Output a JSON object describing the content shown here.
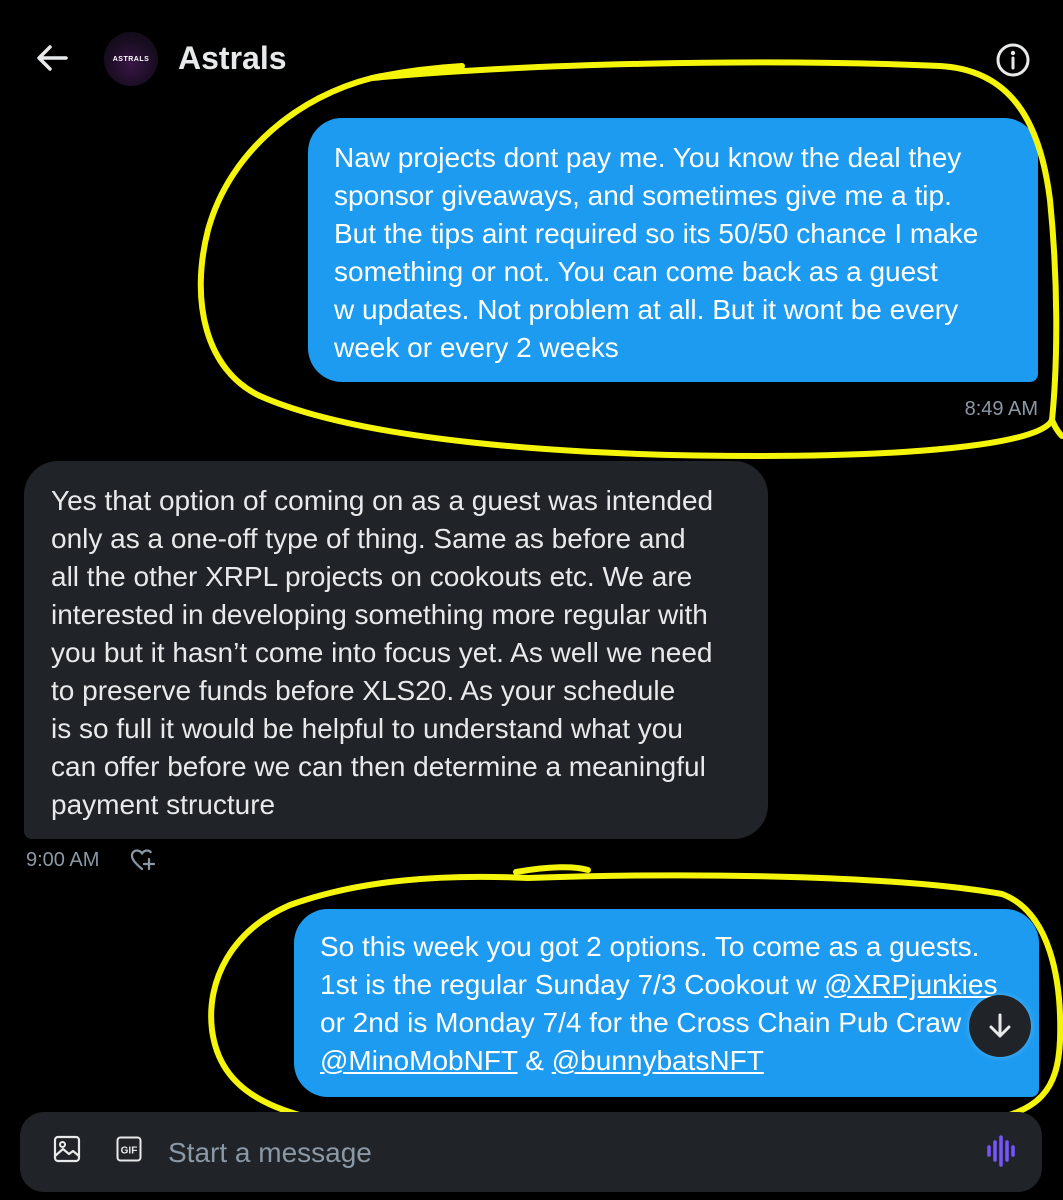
{
  "header": {
    "title": "Astrals",
    "avatar_text": "ASTRALS",
    "back_icon": "arrow-left-icon",
    "info_icon": "info-icon"
  },
  "messages": [
    {
      "direction": "outgoing",
      "text": "Naw projects dont pay me. You know the deal they\nsponsor  giveaways, and sometimes give me a tip.\nBut the tips aint required so its 50/50 chance I make\nsomething or not. You can come back as a guest\nw updates. Not problem at all. But it wont be every\nweek or every 2 weeks",
      "time": "8:49 AM"
    },
    {
      "direction": "incoming",
      "text": "Yes that option of coming on as a guest was intended\nonly as a one-off type of thing. Same as before and\nall the other XRPL projects on cookouts etc. We are\ninterested in developing something more regular with\nyou but it hasn’t come into focus yet. As well we need\nto preserve funds before XLS20. As your schedule\nis so full it would be helpful to understand what you\ncan offer before we can then determine a meaningful\npayment structure",
      "time": "9:00 AM"
    },
    {
      "direction": "outgoing",
      "line1": "So this week you got 2 options. To come as a guests.",
      "line2_prefix": "1st is the regular Sunday 7/3 Cookout w ",
      "mention1": "@XRPjunkies",
      "line3": "or 2nd is Monday 7/4 for the Cross Chain Pub Craw",
      "mention2": "@MinoMobNFT",
      "joiner": " & ",
      "mention3": "@bunnybatsNFT"
    }
  ],
  "composer": {
    "placeholder": "Start a message",
    "media_icon": "image-icon",
    "gif_label": "GIF",
    "voice_icon": "voice-wave-icon"
  },
  "colors": {
    "background": "#000000",
    "outgoing_bubble": "#1d9bf0",
    "incoming_bubble": "#202327",
    "timestamp": "#8b98a5",
    "annotation": "#f5f50a",
    "voice_accent": "#7856ff"
  }
}
